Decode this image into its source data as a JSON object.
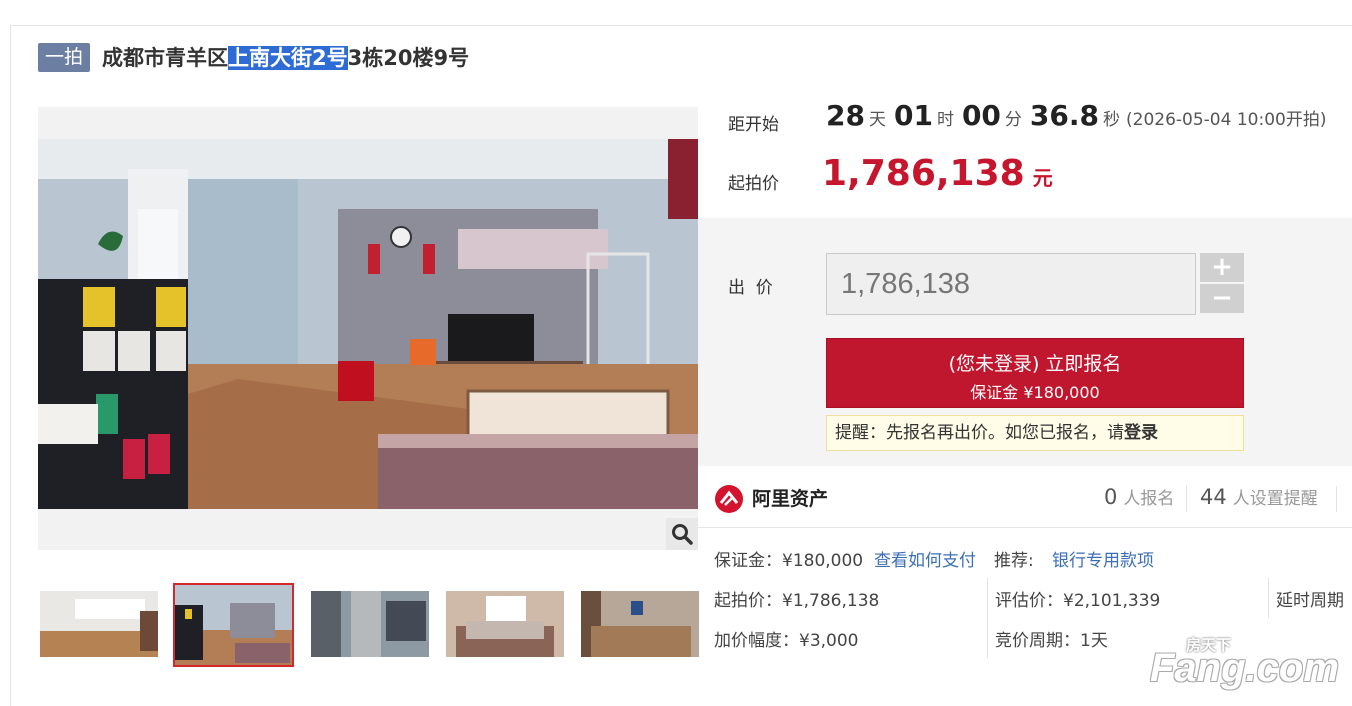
{
  "auction": {
    "round_badge": "一拍",
    "title_pre": "成都市青羊区",
    "title_highlight": "上南大街2号",
    "title_post": "3栋20楼9号"
  },
  "countdown": {
    "label": "距开始",
    "days": "28",
    "days_unit": "天",
    "hours": "01",
    "hours_unit": "时",
    "minutes": "00",
    "minutes_unit": "分",
    "seconds": "36.8",
    "seconds_unit": "秒",
    "start_text": "(2026-05-04 10:00开拍)"
  },
  "price": {
    "label": "起拍价",
    "value": "1,786,138",
    "unit": "元"
  },
  "bid": {
    "label": "出  价",
    "input_value": "1,786,138",
    "plus": "+",
    "minus": "−",
    "signup_line1": "(您未登录) 立即报名",
    "signup_line2": "保证金 ¥180,000",
    "reminder_text": "提醒：先报名再出价。如您已报名，请",
    "reminder_login": "登录"
  },
  "platform": {
    "name": "阿里资产",
    "signups_num": "0",
    "signups_label": "人报名",
    "reminders_num": "44",
    "reminders_label": "人设置提醒"
  },
  "details": {
    "deposit": "保证金：¥180,000",
    "how_to_pay": "查看如何支付",
    "recommend_label": "推荐:",
    "recommend_link": "银行专用款项",
    "start_price": "起拍价：¥1,786,138",
    "appraisal": "评估价：¥2,101,339",
    "delay_period": "延时周期",
    "increment": "加价幅度：¥3,000",
    "bid_period": "竞价周期：1天"
  },
  "watermark": {
    "top": "房天下",
    "brand": "Fang.com"
  },
  "colors": {
    "accent_red": "#c0172f",
    "badge_blue": "#6c7fa3",
    "link_blue": "#3c6fb6"
  }
}
